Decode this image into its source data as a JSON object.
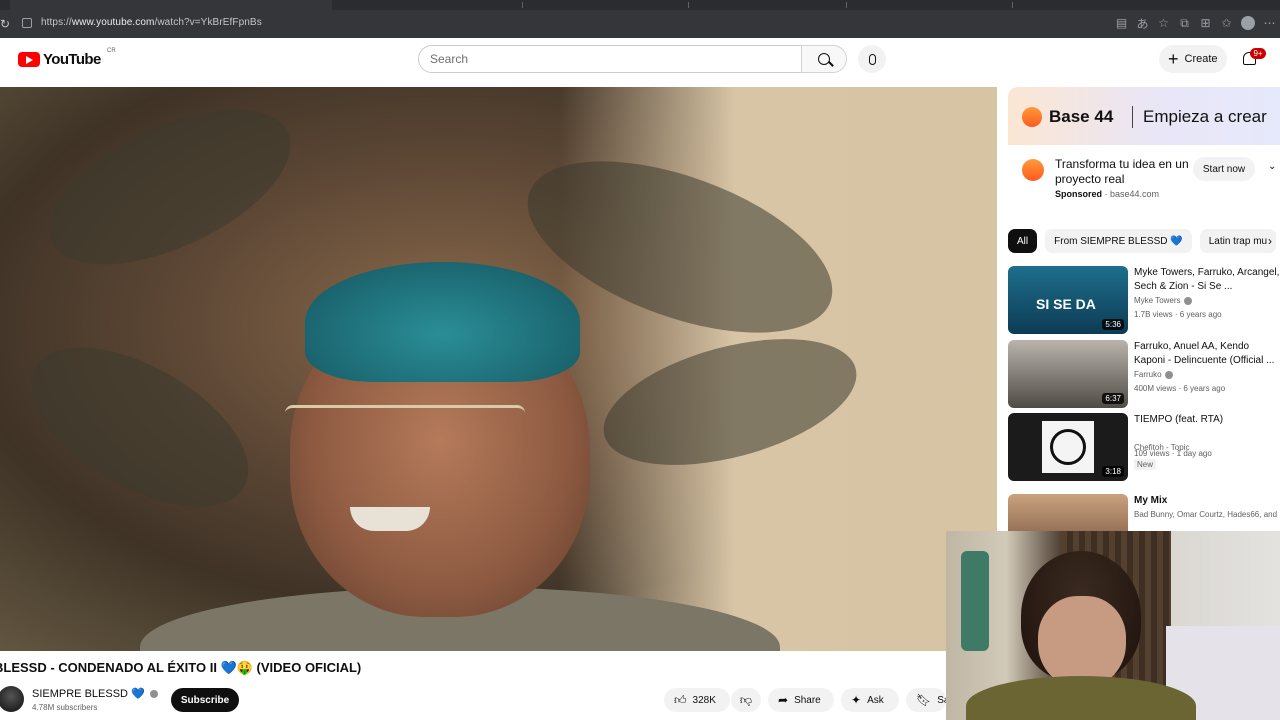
{
  "browser": {
    "url_prefix": "https://",
    "url_host": "www.youtube.com",
    "url_path": "/watch?v=YkBrEfFpnBs",
    "reload_icon": "reload-icon"
  },
  "header": {
    "logo_text": "YouTube",
    "country_code": "CR",
    "search_placeholder": "Search",
    "create_label": "Create",
    "notification_count": "9+"
  },
  "ad": {
    "brand": "Base 44",
    "tagline": "Empieza a crear",
    "title": "Transforma tu idea en un proyecto real",
    "sponsored_label": "Sponsored",
    "domain": "base44.com",
    "cta_label": "Start now"
  },
  "chips": [
    "All",
    "From SIEMPRE BLESSD 💙",
    "Latin trap mu"
  ],
  "recommendations": [
    {
      "title": "Myke Towers, Farruko, Arcangel, Sech & Zion - Si Se ...",
      "channel": "Myke Towers",
      "meta": "1.7B views · 6 years ago",
      "duration": "5:36",
      "thumb_color": "#1d6f8c"
    },
    {
      "title": "Farruko, Anuel AA, Kendo Kaponi - Delincuente (Official ...",
      "channel": "Farruko",
      "meta": "400M views · 6 years ago",
      "duration": "6:37",
      "thumb_color": "#6d6a63"
    },
    {
      "title": "TIEMPO (feat. RTA)",
      "channel": "Chefitoh - Topic",
      "meta": "109 views · 1 day ago",
      "duration": "3:18",
      "badge": "New",
      "thumb_color": "#2b2b2b"
    },
    {
      "title": "My Mix",
      "channel": "Bad Bunny, Omar Courtz, Hades66, and",
      "meta": "",
      "duration": "",
      "thumb_color": "#8a6a55"
    }
  ],
  "video": {
    "title": "BLESSD - CONDENADO AL ÉXITO II 💙🤑 (VIDEO OFICIAL)",
    "channel": "SIEMPRE BLESSD 💙",
    "subscribers": "4.78M subscribers",
    "subscribe_label": "Subscribe",
    "likes": "328K",
    "share_label": "Share",
    "ask_label": "Ask",
    "save_label": "Save"
  }
}
